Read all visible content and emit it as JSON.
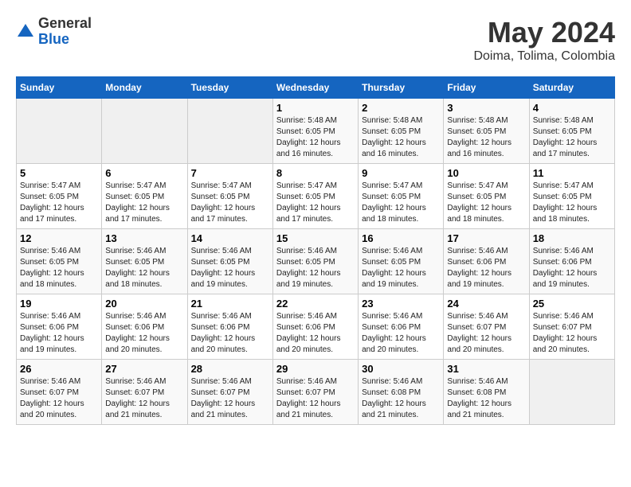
{
  "header": {
    "logo_general": "General",
    "logo_blue": "Blue",
    "month_title": "May 2024",
    "location": "Doima, Tolima, Colombia"
  },
  "weekdays": [
    "Sunday",
    "Monday",
    "Tuesday",
    "Wednesday",
    "Thursday",
    "Friday",
    "Saturday"
  ],
  "weeks": [
    [
      {
        "day": "",
        "content": ""
      },
      {
        "day": "",
        "content": ""
      },
      {
        "day": "",
        "content": ""
      },
      {
        "day": "1",
        "content": "Sunrise: 5:48 AM\nSunset: 6:05 PM\nDaylight: 12 hours and 16 minutes."
      },
      {
        "day": "2",
        "content": "Sunrise: 5:48 AM\nSunset: 6:05 PM\nDaylight: 12 hours and 16 minutes."
      },
      {
        "day": "3",
        "content": "Sunrise: 5:48 AM\nSunset: 6:05 PM\nDaylight: 12 hours and 16 minutes."
      },
      {
        "day": "4",
        "content": "Sunrise: 5:48 AM\nSunset: 6:05 PM\nDaylight: 12 hours and 17 minutes."
      }
    ],
    [
      {
        "day": "5",
        "content": "Sunrise: 5:47 AM\nSunset: 6:05 PM\nDaylight: 12 hours and 17 minutes."
      },
      {
        "day": "6",
        "content": "Sunrise: 5:47 AM\nSunset: 6:05 PM\nDaylight: 12 hours and 17 minutes."
      },
      {
        "day": "7",
        "content": "Sunrise: 5:47 AM\nSunset: 6:05 PM\nDaylight: 12 hours and 17 minutes."
      },
      {
        "day": "8",
        "content": "Sunrise: 5:47 AM\nSunset: 6:05 PM\nDaylight: 12 hours and 17 minutes."
      },
      {
        "day": "9",
        "content": "Sunrise: 5:47 AM\nSunset: 6:05 PM\nDaylight: 12 hours and 18 minutes."
      },
      {
        "day": "10",
        "content": "Sunrise: 5:47 AM\nSunset: 6:05 PM\nDaylight: 12 hours and 18 minutes."
      },
      {
        "day": "11",
        "content": "Sunrise: 5:47 AM\nSunset: 6:05 PM\nDaylight: 12 hours and 18 minutes."
      }
    ],
    [
      {
        "day": "12",
        "content": "Sunrise: 5:46 AM\nSunset: 6:05 PM\nDaylight: 12 hours and 18 minutes."
      },
      {
        "day": "13",
        "content": "Sunrise: 5:46 AM\nSunset: 6:05 PM\nDaylight: 12 hours and 18 minutes."
      },
      {
        "day": "14",
        "content": "Sunrise: 5:46 AM\nSunset: 6:05 PM\nDaylight: 12 hours and 19 minutes."
      },
      {
        "day": "15",
        "content": "Sunrise: 5:46 AM\nSunset: 6:05 PM\nDaylight: 12 hours and 19 minutes."
      },
      {
        "day": "16",
        "content": "Sunrise: 5:46 AM\nSunset: 6:05 PM\nDaylight: 12 hours and 19 minutes."
      },
      {
        "day": "17",
        "content": "Sunrise: 5:46 AM\nSunset: 6:06 PM\nDaylight: 12 hours and 19 minutes."
      },
      {
        "day": "18",
        "content": "Sunrise: 5:46 AM\nSunset: 6:06 PM\nDaylight: 12 hours and 19 minutes."
      }
    ],
    [
      {
        "day": "19",
        "content": "Sunrise: 5:46 AM\nSunset: 6:06 PM\nDaylight: 12 hours and 19 minutes."
      },
      {
        "day": "20",
        "content": "Sunrise: 5:46 AM\nSunset: 6:06 PM\nDaylight: 12 hours and 20 minutes."
      },
      {
        "day": "21",
        "content": "Sunrise: 5:46 AM\nSunset: 6:06 PM\nDaylight: 12 hours and 20 minutes."
      },
      {
        "day": "22",
        "content": "Sunrise: 5:46 AM\nSunset: 6:06 PM\nDaylight: 12 hours and 20 minutes."
      },
      {
        "day": "23",
        "content": "Sunrise: 5:46 AM\nSunset: 6:06 PM\nDaylight: 12 hours and 20 minutes."
      },
      {
        "day": "24",
        "content": "Sunrise: 5:46 AM\nSunset: 6:07 PM\nDaylight: 12 hours and 20 minutes."
      },
      {
        "day": "25",
        "content": "Sunrise: 5:46 AM\nSunset: 6:07 PM\nDaylight: 12 hours and 20 minutes."
      }
    ],
    [
      {
        "day": "26",
        "content": "Sunrise: 5:46 AM\nSunset: 6:07 PM\nDaylight: 12 hours and 20 minutes."
      },
      {
        "day": "27",
        "content": "Sunrise: 5:46 AM\nSunset: 6:07 PM\nDaylight: 12 hours and 21 minutes."
      },
      {
        "day": "28",
        "content": "Sunrise: 5:46 AM\nSunset: 6:07 PM\nDaylight: 12 hours and 21 minutes."
      },
      {
        "day": "29",
        "content": "Sunrise: 5:46 AM\nSunset: 6:07 PM\nDaylight: 12 hours and 21 minutes."
      },
      {
        "day": "30",
        "content": "Sunrise: 5:46 AM\nSunset: 6:08 PM\nDaylight: 12 hours and 21 minutes."
      },
      {
        "day": "31",
        "content": "Sunrise: 5:46 AM\nSunset: 6:08 PM\nDaylight: 12 hours and 21 minutes."
      },
      {
        "day": "",
        "content": ""
      }
    ]
  ]
}
